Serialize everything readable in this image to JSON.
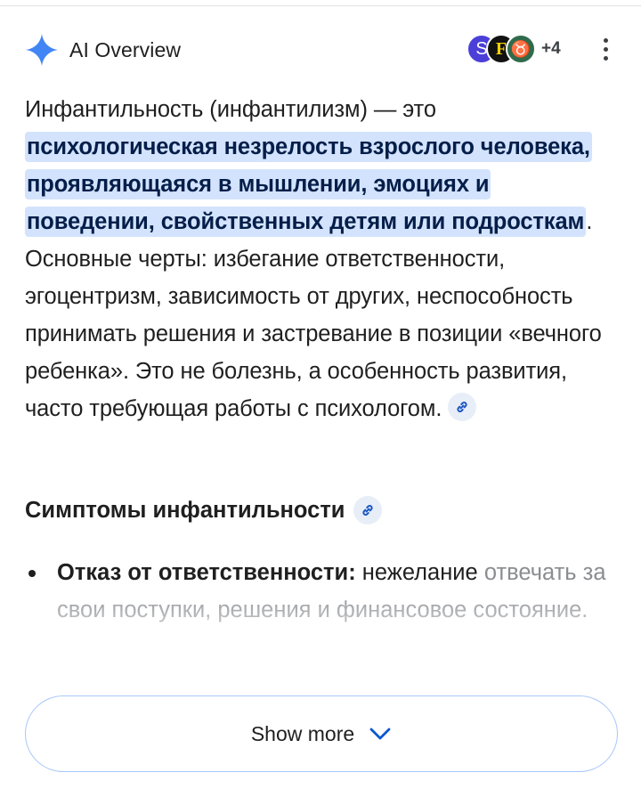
{
  "header": {
    "title": "AI Overview",
    "spark_icon": "gemini-sparkle-icon",
    "spark_color": "#4285f4",
    "avatars": [
      {
        "letter": "S",
        "bg": "#4b3fd8"
      },
      {
        "letter": "F",
        "bg": "#121212"
      },
      {
        "letter": "♉",
        "bg": "#2f6b4c"
      }
    ],
    "more_sources": "+4",
    "menu_icon": "more-vert-icon"
  },
  "overview": {
    "lead": "Инфантильность (инфантилизм) — это ",
    "highlight": "психологическая незрелость взрослого человека, проявляющаяся в мышлении, эмоциях и поведении, свойственных детям или подросткам",
    "rest": ". Основные черты: избегание ответственности, эгоцентризм, зависимость от других, неспособность принимать решения и застревание в позиции «вечного ребенка». Это не болезнь, а особенность развития, часто требующая работы с психологом. ",
    "highlight_bg": "#d3e3fd",
    "link_icon": "link-icon"
  },
  "section": {
    "heading": "Симптомы инфантильности"
  },
  "bullets": [
    {
      "bold": "Отказ от ответственности:",
      "text": " нежелание",
      "faded": "отвечать за свои поступки, решения и финансовое состояние."
    }
  ],
  "show_more": {
    "label": "Show more",
    "icon": "chevron-down-icon",
    "border_color": "#a8c7fa"
  }
}
